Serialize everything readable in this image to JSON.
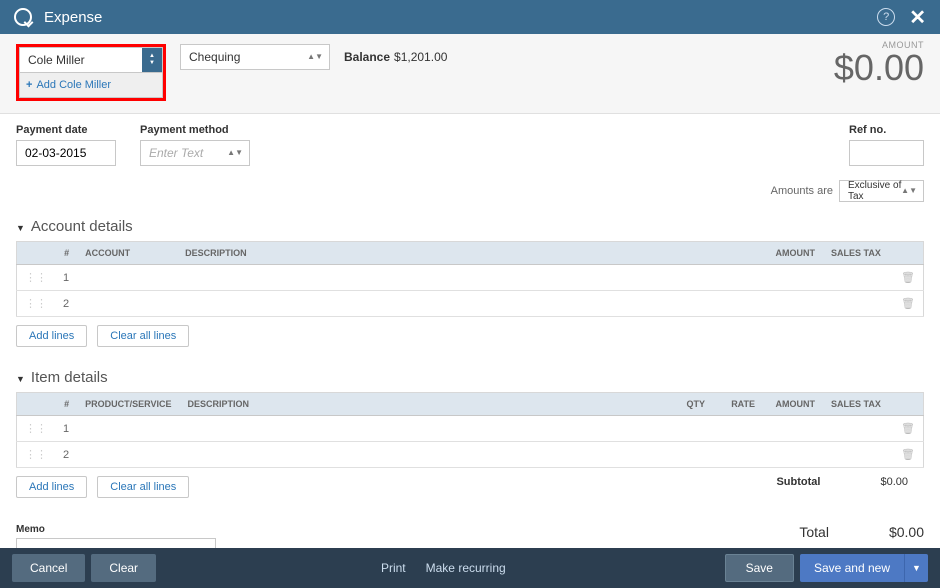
{
  "header": {
    "title": "Expense"
  },
  "payee": {
    "selected": "Cole Miller",
    "add_label": "Add Cole Miller"
  },
  "account_from": {
    "selected": "Chequing"
  },
  "balance": {
    "label": "Balance",
    "value": "$1,201.00"
  },
  "amount": {
    "label": "AMOUNT",
    "value": "$0.00"
  },
  "payment_date": {
    "label": "Payment date",
    "value": "02-03-2015"
  },
  "payment_method": {
    "label": "Payment method",
    "placeholder": "Enter Text"
  },
  "ref_no": {
    "label": "Ref no."
  },
  "tax": {
    "label": "Amounts are",
    "value": "Exclusive of Tax"
  },
  "account_details": {
    "title": "Account details",
    "columns": {
      "idx": "#",
      "account": "ACCOUNT",
      "description": "DESCRIPTION",
      "amount": "AMOUNT",
      "salestax": "SALES TAX"
    },
    "rows": [
      {
        "idx": "1"
      },
      {
        "idx": "2"
      }
    ]
  },
  "item_details": {
    "title": "Item details",
    "columns": {
      "idx": "#",
      "product": "PRODUCT/SERVICE",
      "description": "DESCRIPTION",
      "qty": "QTY",
      "rate": "RATE",
      "amount": "AMOUNT",
      "salestax": "SALES TAX"
    },
    "rows": [
      {
        "idx": "1"
      },
      {
        "idx": "2"
      }
    ]
  },
  "line_buttons": {
    "add": "Add lines",
    "clear": "Clear all lines"
  },
  "subtotal": {
    "label": "Subtotal",
    "value": "$0.00"
  },
  "memo": {
    "label": "Memo"
  },
  "total": {
    "label": "Total",
    "value": "$0.00"
  },
  "footer": {
    "cancel": "Cancel",
    "clear": "Clear",
    "print": "Print",
    "recurring": "Make recurring",
    "save": "Save",
    "save_new": "Save and new"
  }
}
